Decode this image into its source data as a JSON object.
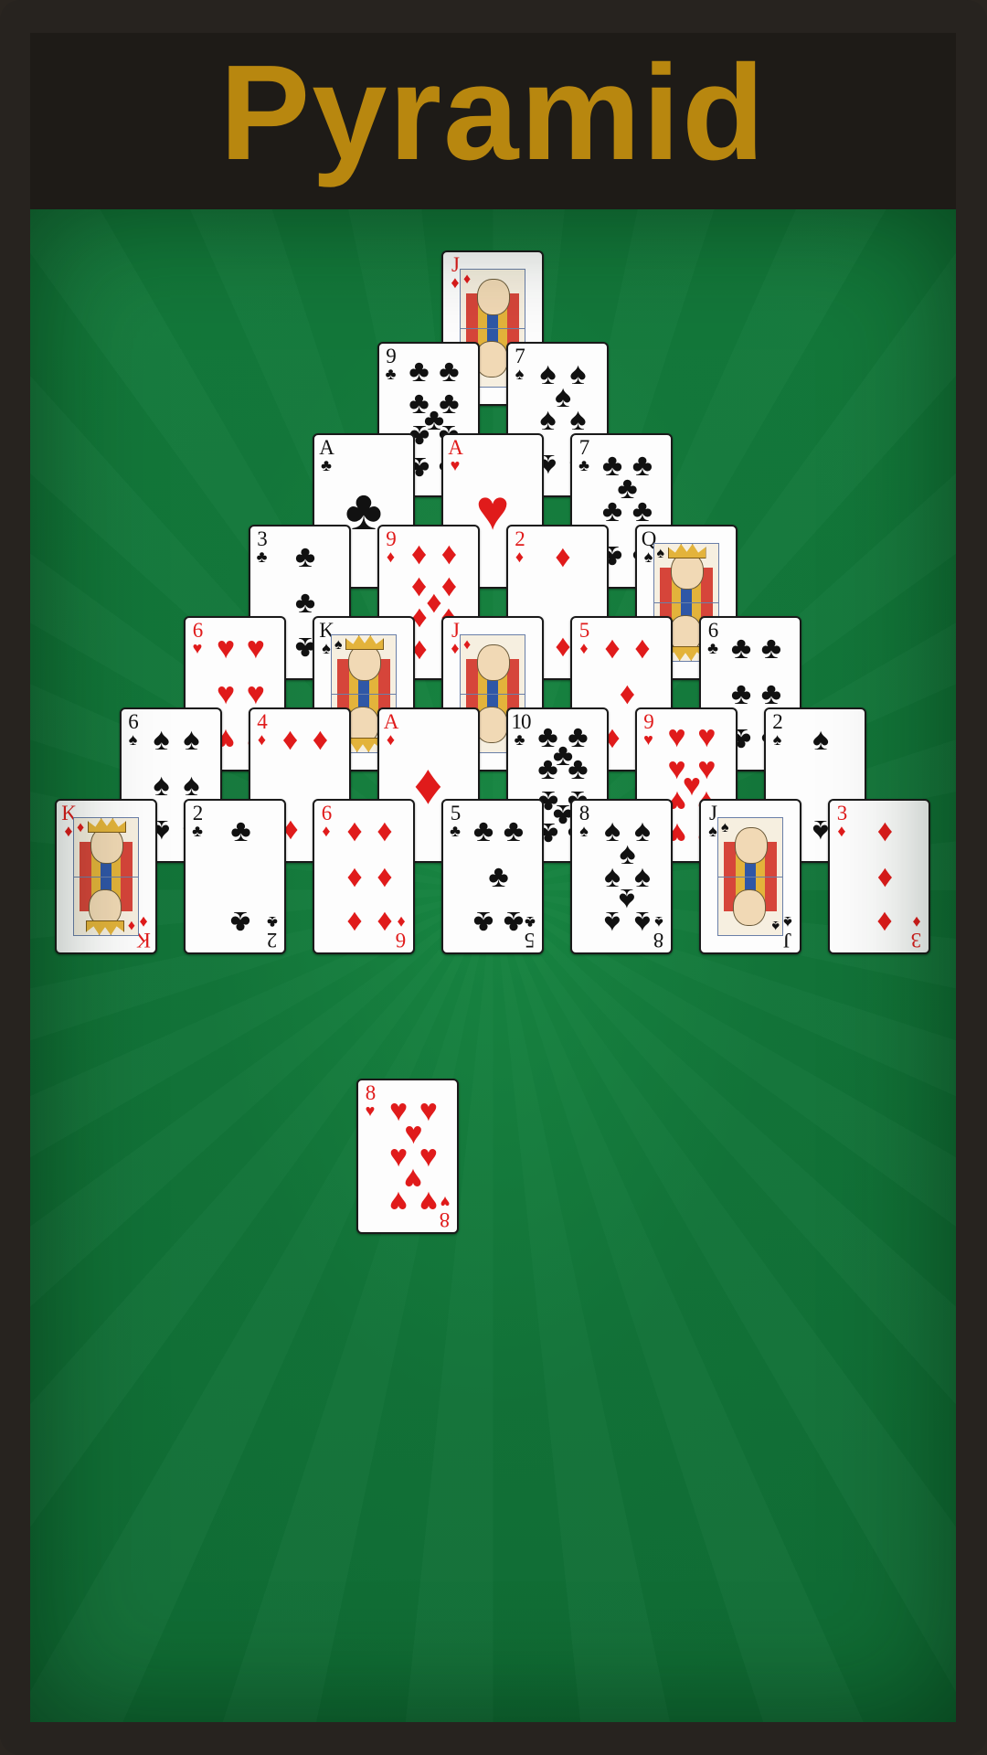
{
  "header": {
    "title": "Pyramid",
    "title_color": "#b8870f"
  },
  "table": {
    "felt_color": "#137a3b"
  },
  "suits": {
    "spades": "♠",
    "hearts": "♥",
    "diamonds": "♦",
    "clubs": "♣"
  },
  "pyramid_rows": [
    [
      {
        "rank": "J",
        "suit": "diamonds"
      }
    ],
    [
      {
        "rank": "9",
        "suit": "clubs"
      },
      {
        "rank": "7",
        "suit": "spades"
      }
    ],
    [
      {
        "rank": "A",
        "suit": "clubs"
      },
      {
        "rank": "A",
        "suit": "hearts"
      },
      {
        "rank": "7",
        "suit": "clubs"
      }
    ],
    [
      {
        "rank": "3",
        "suit": "clubs"
      },
      {
        "rank": "9",
        "suit": "diamonds"
      },
      {
        "rank": "2",
        "suit": "diamonds"
      },
      {
        "rank": "Q",
        "suit": "spades"
      }
    ],
    [
      {
        "rank": "6",
        "suit": "hearts"
      },
      {
        "rank": "K",
        "suit": "spades"
      },
      {
        "rank": "J",
        "suit": "diamonds"
      },
      {
        "rank": "5",
        "suit": "diamonds"
      },
      {
        "rank": "6",
        "suit": "clubs"
      }
    ],
    [
      {
        "rank": "6",
        "suit": "spades"
      },
      {
        "rank": "4",
        "suit": "diamonds"
      },
      {
        "rank": "A",
        "suit": "diamonds"
      },
      {
        "rank": "10",
        "suit": "clubs"
      },
      {
        "rank": "9",
        "suit": "hearts"
      },
      {
        "rank": "2",
        "suit": "spades"
      }
    ],
    [
      {
        "rank": "K",
        "suit": "diamonds"
      },
      {
        "rank": "2",
        "suit": "clubs"
      },
      {
        "rank": "6",
        "suit": "diamonds"
      },
      {
        "rank": "5",
        "suit": "clubs"
      },
      {
        "rank": "8",
        "suit": "spades"
      },
      {
        "rank": "J",
        "suit": "spades"
      },
      {
        "rank": "3",
        "suit": "diamonds"
      }
    ]
  ],
  "waste_card": {
    "rank": "8",
    "suit": "hearts"
  }
}
